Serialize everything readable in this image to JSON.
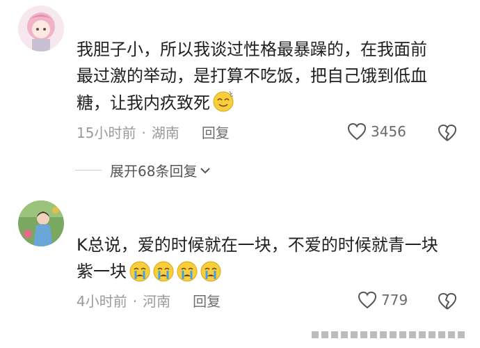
{
  "comments": [
    {
      "text": "我胆子小，所以我谈过性格最暴躁的，在我面前最过激的举动，是打算不吃饭，把自己饿到低血糖，让我内疚致死",
      "lines": [
        "我胆子小，所以我谈过性格最暴躁的，在我面前",
        "最过激的举动，是打算不吃饭，把自己饿到低血",
        "糖，让我内疚致死"
      ],
      "emoji": "dizzy-face-emoji",
      "time": "15小时前",
      "location": "湖南",
      "reply_label": "回复",
      "likes": "3456",
      "expand_label": "展开68条回复"
    },
    {
      "lines": [
        "K总说，爱的时候就在一块，不爱的时候就青一块",
        "紫一块"
      ],
      "emoji": "crying-face-emoji",
      "time": "4小时前",
      "location": "河南",
      "reply_label": "回复",
      "likes": "779"
    }
  ],
  "colors": {
    "muted": "#9a9a9a",
    "text": "#202020"
  }
}
